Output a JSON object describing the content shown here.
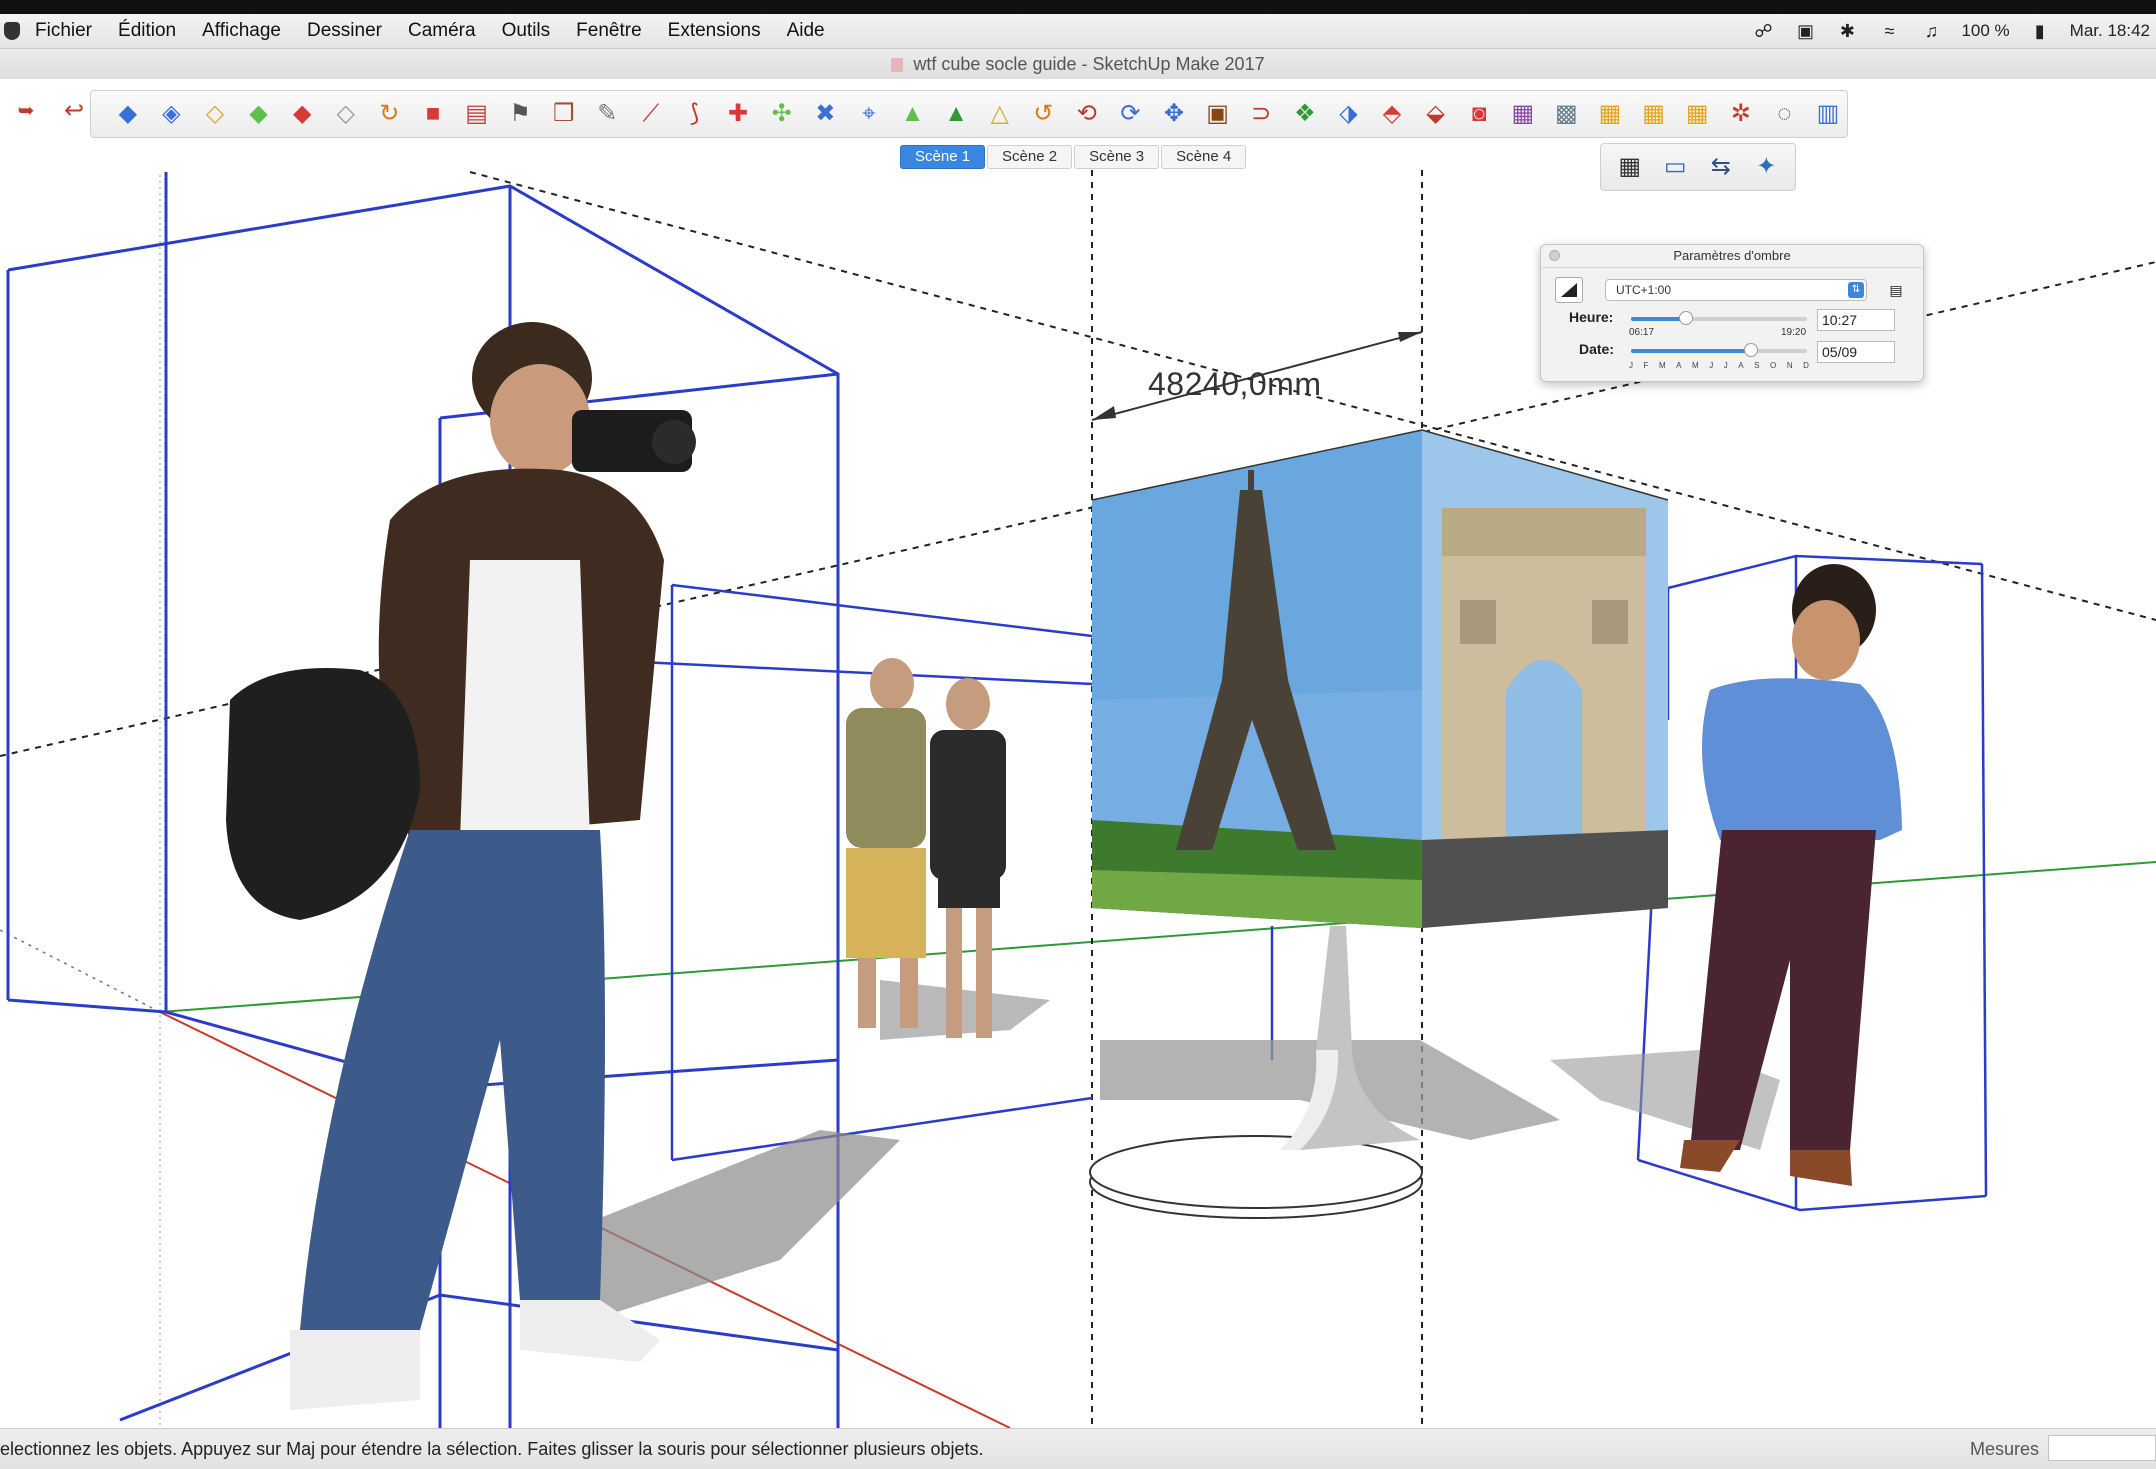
{
  "menubar": {
    "items": [
      "Fichier",
      "Édition",
      "Affichage",
      "Dessiner",
      "Caméra",
      "Outils",
      "Fenêtre",
      "Extensions",
      "Aide"
    ],
    "battery": "100 %",
    "clock": "Mar. 18:42"
  },
  "window": {
    "title": "wtf cube  socle guide - SketchUp Make 2017"
  },
  "toolbar": {
    "icons": [
      "components-icon",
      "top-view-icon",
      "front-view-icon",
      "right-view-icon",
      "back-view-icon",
      "left-view-icon",
      "orbit-icon",
      "xray-icon",
      "section-plane-icon",
      "flag-icon",
      "book-icon",
      "wrench-icon",
      "line-icon",
      "arc-icon",
      "cross-icon",
      "push-pull-icon",
      "rotate-icon",
      "intersect-icon",
      "cone-icon",
      "tetra-icon",
      "triangle-icon",
      "curve-icon",
      "loop-icon",
      "spin-icon",
      "move-icon",
      "box-icon",
      "magnet-icon",
      "extrude-icon",
      "scale-icon",
      "mirror-icon",
      "shear-icon",
      "paint-icon",
      "grid-icon",
      "pattern-icon",
      "tile-icon",
      "tile-alt-icon",
      "tile-grid-icon",
      "explode-icon",
      "circle-dots-icon",
      "sort-icon"
    ],
    "secondary": [
      "film-icon",
      "display-icon",
      "settings-sliders-icon",
      "solar-icon"
    ]
  },
  "scenes": {
    "tabs": [
      "Scène 1",
      "Scène 2",
      "Scène 3",
      "Scène 4"
    ],
    "active": "Scène 1"
  },
  "dimension": {
    "label": "48240,0mm"
  },
  "shadow_panel": {
    "title": "Paramètres d'ombre",
    "timezone": "UTC+1:00",
    "heure_label": "Heure:",
    "heure_start": "06:17",
    "heure_end": "19:20",
    "heure_value": "10:27",
    "heure_position": 0.31,
    "date_label": "Date:",
    "date_value": "05/09",
    "date_position": 0.68,
    "months": [
      "J",
      "F",
      "M",
      "A",
      "M",
      "J",
      "J",
      "A",
      "S",
      "O",
      "N",
      "D"
    ]
  },
  "statusbar": {
    "message": "electionnez les objets. Appuyez sur Maj pour étendre la sélection. Faites glisser la souris pour sélectionner plusieurs objets.",
    "measure_label": "Mesures",
    "measure_value": ""
  },
  "colors": {
    "accent": "#3a87e0",
    "box_lines": "#2a3cc8",
    "axis_green": "#2e9a36",
    "axis_red": "#c83a2a"
  }
}
